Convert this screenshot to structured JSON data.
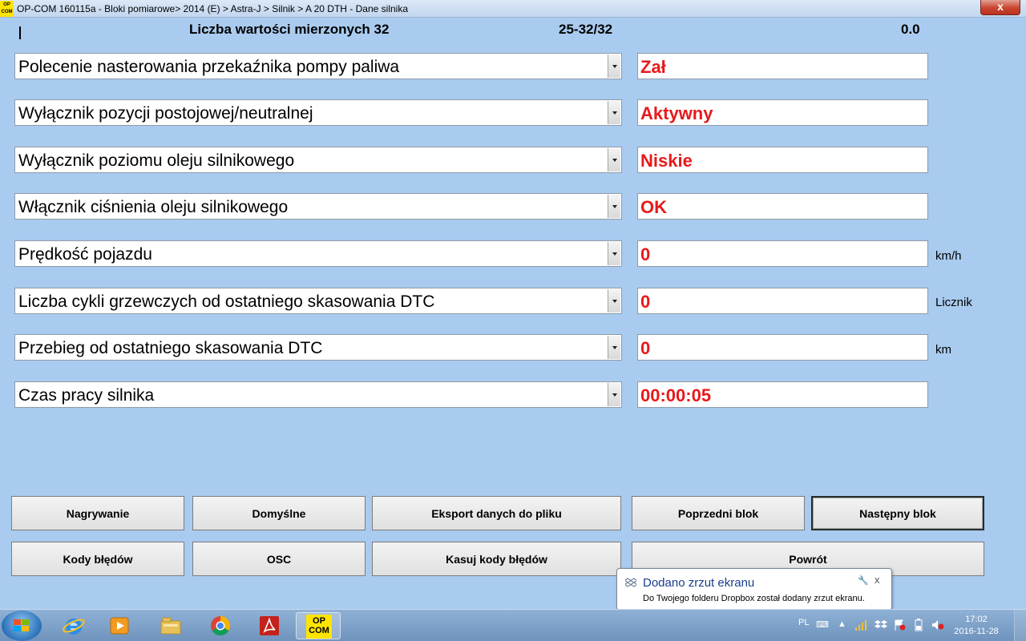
{
  "window": {
    "app_icon_text": [
      "OP",
      "COM"
    ],
    "title": "OP-COM 160115a - Bloki pomiarowe> 2014 (E) > Astra-J > Silnik > A 20 DTH - Dane silnika",
    "close_label": "x"
  },
  "header": {
    "count_label": "Liczba wartości mierzonych 32",
    "range_label": "25-32/32",
    "value_label": "0.0"
  },
  "rows": [
    {
      "label": "Polecenie nasterowania przekaźnika pompy paliwa",
      "value": "Zał",
      "unit": ""
    },
    {
      "label": "Wyłącznik pozycji postojowej/neutralnej",
      "value": "Aktywny",
      "unit": ""
    },
    {
      "label": "Wyłącznik poziomu oleju silnikowego",
      "value": "Niskie",
      "unit": ""
    },
    {
      "label": "Włącznik ciśnienia oleju silnikowego",
      "value": "OK",
      "unit": ""
    },
    {
      "label": "Prędkość pojazdu",
      "value": "0",
      "unit": "km/h"
    },
    {
      "label": "Liczba cykli grzewczych od ostatniego skasowania DTC",
      "value": "0",
      "unit": "Licznik"
    },
    {
      "label": "Przebieg od ostatniego skasowania DTC",
      "value": "0",
      "unit": "km"
    },
    {
      "label": "Czas pracy silnika",
      "value": "00:00:05",
      "unit": ""
    }
  ],
  "buttons": {
    "record": "Nagrywanie",
    "default": "Domyślne",
    "export": "Eksport danych do pliku",
    "prev_block": "Poprzedni blok",
    "next_block": "Następny blok",
    "error_codes": "Kody błędów",
    "osc": "OSC",
    "clear_codes": "Kasuj kody błędów",
    "back": "Powrót"
  },
  "notification": {
    "title": "Dodano zrzut ekranu",
    "body": "Do Twojego folderu Dropbox został dodany zrzut ekranu.",
    "close_label": "x"
  },
  "taskbar": {
    "opcom_icon_text": [
      "OP",
      "COM"
    ],
    "language": "PL",
    "time": "17:02",
    "date": "2016-11-28"
  },
  "colors": {
    "background": "#a9cbef",
    "value_text": "#e8191b",
    "notification_title": "#1b3d8f"
  }
}
